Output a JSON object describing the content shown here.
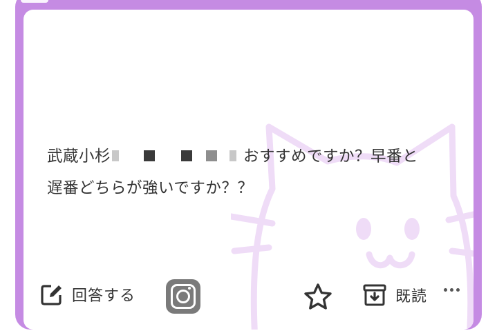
{
  "post": {
    "question_line1_start": "武蔵小杉",
    "question_line1_end": "おすすめですか？早番と",
    "question_line2": "遅番どちらが強いですか？？"
  },
  "actions": {
    "answer_label": "回答する",
    "read_label": "既読"
  },
  "icons": {
    "answer": "edit-icon",
    "instagram": "instagram-icon",
    "favorite": "star-icon",
    "read": "archive-icon",
    "more": "more-icon"
  },
  "colors": {
    "frame": "#c58be3",
    "cat_watermark": "#efdcf7",
    "text": "#333333"
  }
}
